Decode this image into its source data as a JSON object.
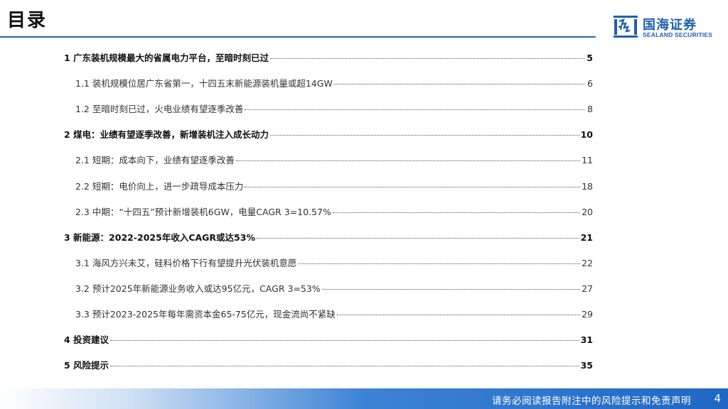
{
  "header": {
    "title": "目录",
    "logo": {
      "cn": "国海证券",
      "en": "SEALAND SECURITIES",
      "brand_color": "#1f5fb0"
    }
  },
  "toc": [
    {
      "level": 1,
      "text": "1 广东装机规模最大的省属电力平台，至暗时刻已过",
      "page": "5"
    },
    {
      "level": 2,
      "text": "1.1 装机规模位居广东省第一，十四五末新能源装机量或超14GW",
      "page": "6"
    },
    {
      "level": 2,
      "text": "1.2 至暗时刻已过，火电业绩有望逐季改善",
      "page": "8"
    },
    {
      "level": 1,
      "text": "2 煤电：业绩有望逐季改善，新增装机注入成长动力",
      "page": "10"
    },
    {
      "level": 2,
      "text": "2.1 短期：成本向下，业绩有望逐季改善",
      "page": "11"
    },
    {
      "level": 2,
      "text": "2.2 短期：电价向上，进一步疏导成本压力",
      "page": "18"
    },
    {
      "level": 2,
      "text": "2.3 中期：“十四五”预计新增装机6GW，电量CAGR 3=10.57%",
      "page": "20"
    },
    {
      "level": 1,
      "text": "3 新能源：2022-2025年收入CAGR或达53%",
      "page": "21"
    },
    {
      "level": 2,
      "text": "3.1 海风方兴未艾，硅料价格下行有望提升光伏装机意愿",
      "page": "22"
    },
    {
      "level": 2,
      "text": "3.2 预计2025年新能源业务收入或达95亿元，CAGR 3=53%",
      "page": "27"
    },
    {
      "level": 2,
      "text": "3.3 预计2023-2025年每年需资本金65-75亿元，现金流尚不紧缺",
      "page": "29"
    },
    {
      "level": 1,
      "text": "4 投资建议",
      "page": "31"
    },
    {
      "level": 1,
      "text": "5 风险提示",
      "page": "35"
    }
  ],
  "footer": {
    "disclaimer": "请务必阅读报告附注中的风险提示和免责声明",
    "page_number": "4"
  }
}
